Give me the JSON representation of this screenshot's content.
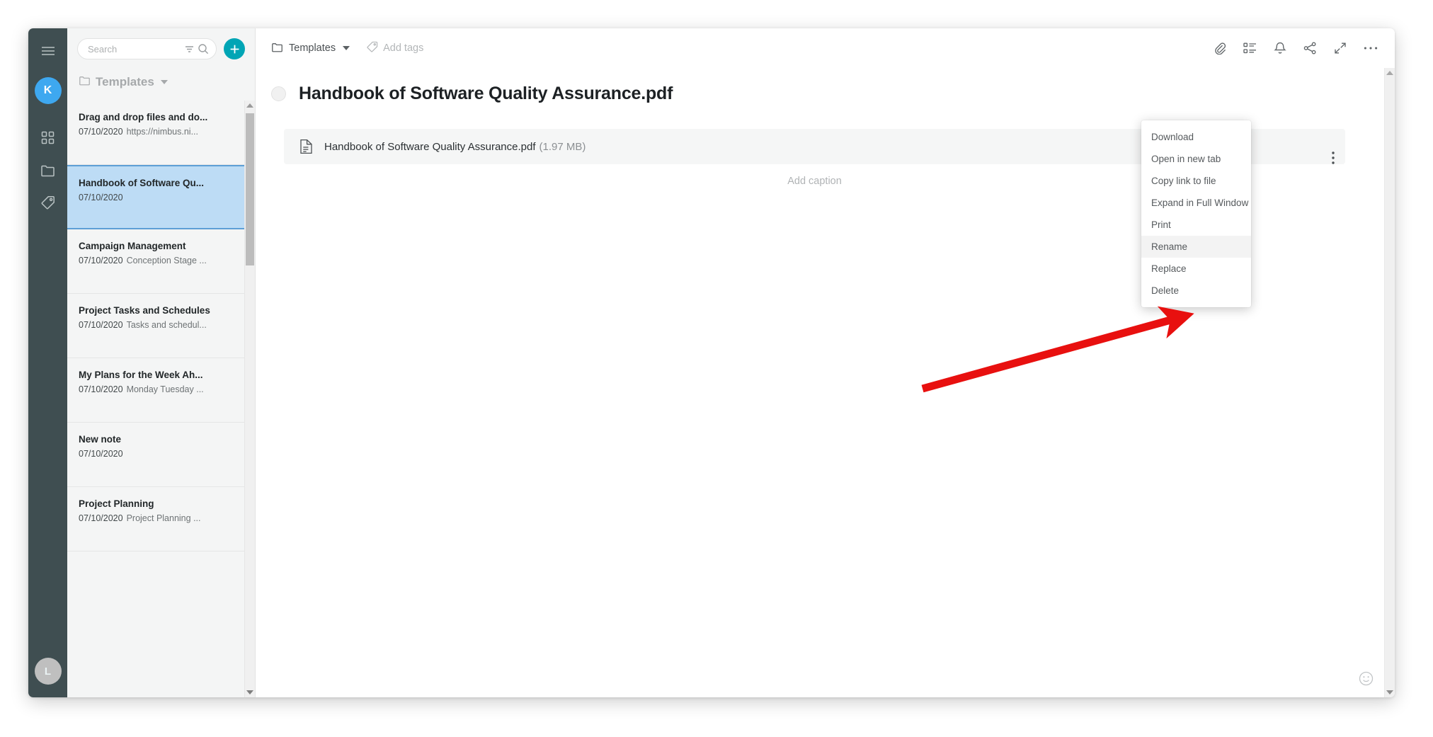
{
  "rail": {
    "menu_icon": "hamburger-icon",
    "workspace_avatar": "K",
    "items": [
      {
        "icon": "grid-icon"
      },
      {
        "icon": "folder-icon"
      },
      {
        "icon": "tag-icon"
      }
    ],
    "user_avatar": "L"
  },
  "list_panel": {
    "search": {
      "placeholder": "Search",
      "value": "",
      "filter_icon": "filter-icon",
      "search_icon": "search-icon"
    },
    "add_button": {
      "label": "+",
      "color": "#00a5b5"
    },
    "folder": {
      "label": "Templates",
      "icon": "folder-icon",
      "caret": "chevron-down-icon"
    },
    "notes": [
      {
        "title": "Drag and drop files and do...",
        "date": "07/10/2020",
        "preview": "https://nimbus.ni...",
        "selected": false
      },
      {
        "title": "Handbook of Software Qu...",
        "date": "07/10/2020",
        "preview": "",
        "selected": true
      },
      {
        "title": "Campaign Management",
        "date": "07/10/2020",
        "preview": "Conception Stage ...",
        "selected": false
      },
      {
        "title": "Project Tasks and Schedules",
        "date": "07/10/2020",
        "preview": "Tasks and schedul...",
        "selected": false
      },
      {
        "title": "My Plans for the Week Ah...",
        "date": "07/10/2020",
        "preview": "Monday Tuesday ...",
        "selected": false
      },
      {
        "title": "New note",
        "date": "07/10/2020",
        "preview": "",
        "selected": false
      },
      {
        "title": "Project Planning",
        "date": "07/10/2020",
        "preview": "Project Planning ...",
        "selected": false
      }
    ]
  },
  "toolbar": {
    "breadcrumb": {
      "label": "Templates",
      "icon": "folder-icon",
      "caret": "chevron-down-icon"
    },
    "add_tags": {
      "label": "Add tags",
      "icon": "tag-icon"
    },
    "icons": [
      {
        "name": "attachment-icon"
      },
      {
        "name": "outline-icon"
      },
      {
        "name": "bell-icon"
      },
      {
        "name": "share-icon"
      },
      {
        "name": "expand-icon"
      },
      {
        "name": "more-icon"
      }
    ]
  },
  "document": {
    "title": "Handbook of Software Quality Assurance.pdf",
    "attachment": {
      "icon": "file-document-icon",
      "name": "Handbook of Software Quality Assurance.pdf",
      "size": "(1.97 MB)",
      "kebab": "more-vertical-icon"
    },
    "caption_placeholder": "Add caption",
    "feedback_icon": "smiley-icon"
  },
  "context_menu": {
    "items": [
      {
        "label": "Download",
        "highlight": false
      },
      {
        "label": "Open in new tab",
        "highlight": false
      },
      {
        "label": "Copy link to file",
        "highlight": false
      },
      {
        "label": "Expand in Full Window",
        "highlight": false
      },
      {
        "label": "Print",
        "highlight": false
      },
      {
        "label": "Rename",
        "highlight": true
      },
      {
        "label": "Replace",
        "highlight": false
      },
      {
        "label": "Delete",
        "highlight": false
      }
    ]
  },
  "annotation": {
    "arrow_color": "#e8100f",
    "points_to": "Rename"
  }
}
